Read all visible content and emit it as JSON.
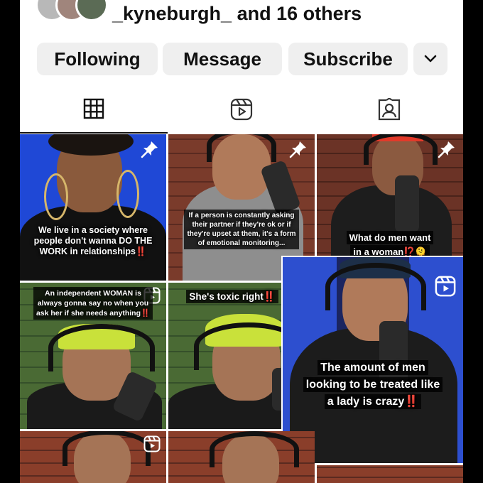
{
  "followed_by": {
    "handle": "_kyneburgh_",
    "rest": " and 16 others"
  },
  "actions": {
    "following": "Following",
    "message": "Message",
    "subscribe": "Subscribe"
  },
  "icons": {
    "chevron": "chevron-down-icon",
    "grid": "grid-icon",
    "reels": "reels-icon",
    "tagged": "tagged-icon",
    "pin": "pin-icon",
    "reel_badge": "reel-badge-icon"
  },
  "colors": {
    "button_bg": "#efefef",
    "caption_red": "#ff2a2a",
    "blue_studio": "#1e4fd8",
    "beanie_yellow": "#c9e13a"
  },
  "posts": [
    {
      "id": 1,
      "caption_lines": [
        "We live in a society where",
        "people don't wanna DO THE",
        "WORK in relationships‼️"
      ],
      "pinned": true
    },
    {
      "id": 2,
      "caption_lines": [
        "If a person is constantly asking",
        "their partner if they're ok or if",
        "they're upset at them, it's a form",
        "of emotional monitoring..."
      ],
      "pinned": true
    },
    {
      "id": 3,
      "caption_lines": [
        "What do men want",
        "in a woman⁉️🫠"
      ],
      "pinned": true
    },
    {
      "id": 4,
      "caption_lines": [
        "An independent WOMAN is",
        "always gonna say no when you",
        "ask her if she needs anything‼️"
      ],
      "reel": true
    },
    {
      "id": 5,
      "caption_lines": [
        "She's toxic right‼️"
      ],
      "reel": true
    },
    {
      "id": 6,
      "caption_lines": [
        "The amount of men",
        "looking to be treated like",
        "a lady is crazy‼️"
      ],
      "reel": true
    },
    {
      "id": 7,
      "caption_lines": [],
      "reel": true
    },
    {
      "id": 8,
      "caption_lines": [],
      "reel": false
    },
    {
      "id": 9,
      "caption_lines": [],
      "reel": false
    }
  ]
}
